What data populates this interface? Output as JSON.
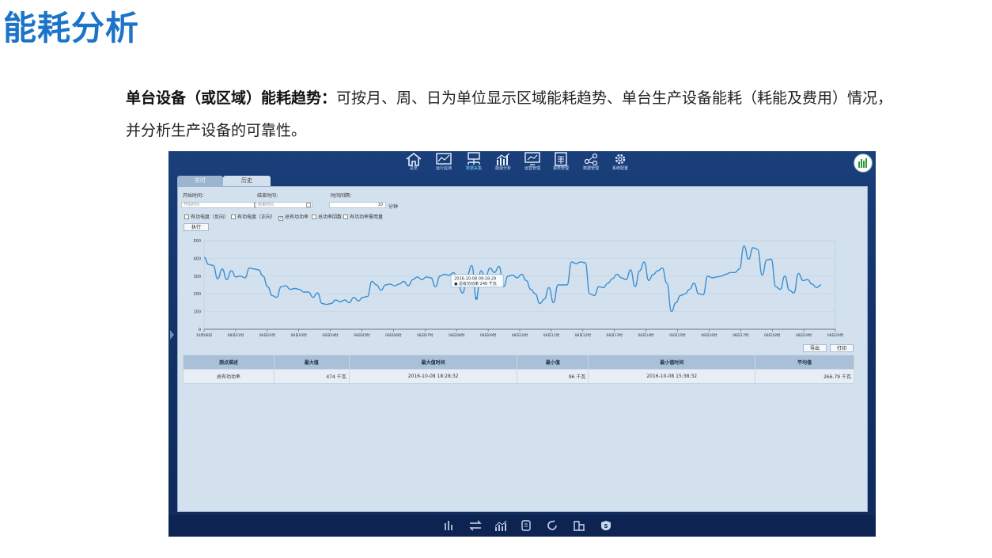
{
  "page_title": "能耗分析",
  "description": {
    "bold": "单台设备（或区域）能耗趋势：",
    "text": "可按月、周、日为单位显示区域能耗趋势、单台生产设备能耗（耗能及费用）情况，",
    "line2": "并分析生产设备的可靠性。"
  },
  "nav": {
    "items": [
      {
        "label": "总览",
        "icon": "home-icon"
      },
      {
        "label": "运行监测",
        "icon": "monitor-chart-icon"
      },
      {
        "label": "数据采集",
        "icon": "network-icon"
      },
      {
        "label": "能源分析",
        "icon": "bar-trend-icon"
      },
      {
        "label": "运营管理",
        "icon": "screen-chart-icon"
      },
      {
        "label": "报表管理",
        "icon": "report-icon"
      },
      {
        "label": "数据管理",
        "icon": "data-graph-icon"
      },
      {
        "label": "系统配置",
        "icon": "gear-icon"
      }
    ],
    "active_index": 2
  },
  "tabs": [
    "实时",
    "历史"
  ],
  "active_tab": 1,
  "form": {
    "start_label": "开始时间：",
    "start_placeholder": "开始时间",
    "end_label": "结束时间：",
    "end_placeholder": "结束时间",
    "interval_label": "时间间隔：",
    "interval_value": "10",
    "interval_unit": "分钟",
    "checkboxes": [
      {
        "label": "有功电度（反向）",
        "checked": false
      },
      {
        "label": "有功电度（正向）",
        "checked": false
      },
      {
        "label": "总有功功率",
        "checked": true
      },
      {
        "label": "总功率因数",
        "checked": false
      },
      {
        "label": "有功功率需用量",
        "checked": false
      }
    ],
    "execute_label": "执行"
  },
  "chart_data": {
    "type": "line",
    "ylim": [
      0,
      500
    ],
    "yticks": [
      "0",
      "100",
      "200",
      "300",
      "400",
      "500"
    ],
    "xticks": [
      "10月08日",
      "08日01时",
      "08日02时",
      "08日03时",
      "08日04时",
      "08日05时",
      "08日06时",
      "08日07时",
      "08日08时",
      "08日09时",
      "08日10时",
      "08日11时",
      "08日12时",
      "08日13时",
      "08日14时",
      "08日15时",
      "08日16时",
      "08日17时",
      "08日18时",
      "08日19时",
      "08日20时"
    ],
    "series": [
      {
        "name": "总有功功率",
        "color": "#3a8fd0",
        "values": [
          405,
          365,
          360,
          285,
          340,
          280,
          330,
          295,
          300,
          290,
          345,
          340,
          335,
          300,
          240,
          190,
          180,
          240,
          245,
          225,
          230,
          225,
          210,
          210,
          180,
          205,
          145,
          140,
          145,
          165,
          155,
          165,
          150,
          180,
          160,
          180,
          185,
          270,
          250,
          220,
          250,
          255,
          245,
          255,
          270,
          245,
          280,
          295,
          280,
          295,
          290,
          240,
          300,
          310,
          305,
          320,
          245,
          205,
          305,
          360,
          175,
          330,
          290,
          345,
          320,
          355,
          240,
          300,
          305,
          290,
          310,
          275,
          225,
          200,
          145,
          170,
          235,
          150,
          250,
          250,
          250,
          380,
          370,
          380,
          375,
          200,
          190,
          240,
          235,
          260,
          285,
          310,
          290,
          280,
          335,
          240,
          330,
          380,
          275,
          310,
          330,
          345,
          260,
          100,
          150,
          190,
          200,
          225,
          260,
          200,
          195,
          300,
          290,
          295,
          300,
          310,
          320,
          320,
          340,
          470,
          395,
          460,
          450,
          305,
          390,
          395,
          240,
          225,
          300,
          220,
          205,
          315,
          275,
          280,
          255,
          235,
          250
        ]
      }
    ],
    "tooltip": {
      "time": "2016-10-08 09:18:29",
      "series": "总有功功率",
      "value": "246 千瓦",
      "point_index": 60
    }
  },
  "actions": {
    "export": "导出",
    "print": "打印"
  },
  "table": {
    "headers": [
      "测点描述",
      "最大值",
      "最大值时间",
      "最小值",
      "最小值时间",
      "平均值"
    ],
    "rows": [
      [
        "总有功功率",
        "474 千瓦",
        "2016-10-08 18:28:32",
        "96 千瓦",
        "2016-10-08 15:38:32",
        "266.79 千瓦"
      ]
    ]
  },
  "bottom_icons": [
    "gauge-icon",
    "switch-icon",
    "bar-trend-icon",
    "meter-icon",
    "refresh-icon",
    "building-icon",
    "shield-icon"
  ]
}
